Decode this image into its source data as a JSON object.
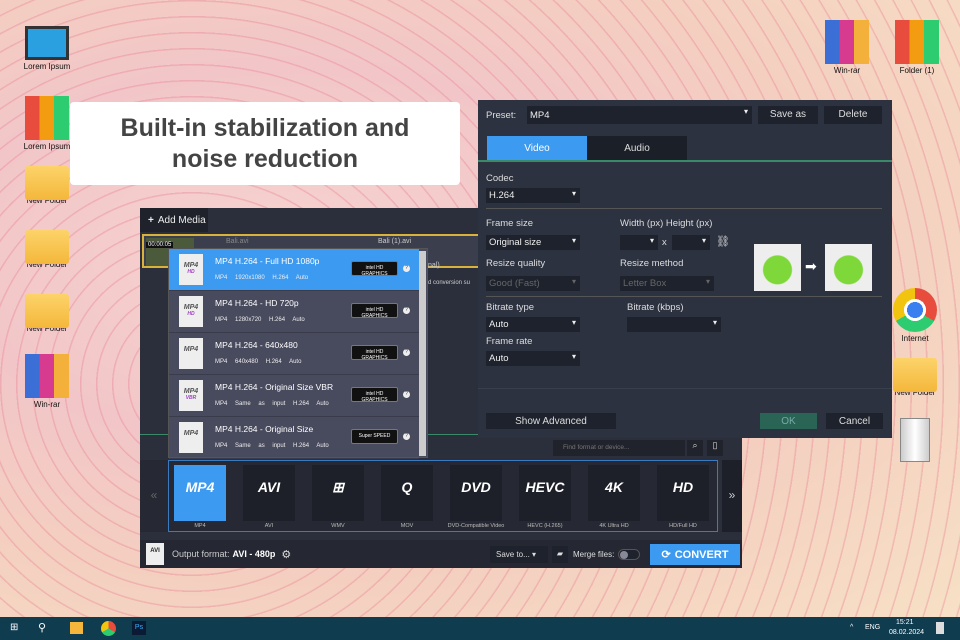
{
  "banner": {
    "text": "Built-in stabilization and noise reduction"
  },
  "desktop": {
    "left": [
      {
        "label": "Lorem Ipsum",
        "icon": "computer-icon"
      },
      {
        "label": "Lorem Ipsum",
        "icon": "binders-icon"
      },
      {
        "label": "New Folder",
        "icon": "folder-icon"
      },
      {
        "label": "New Folder",
        "icon": "folder-icon"
      },
      {
        "label": "New Folder",
        "icon": "folder-icon"
      },
      {
        "label": "Win-rar",
        "icon": "winrar-icon"
      }
    ],
    "right": [
      {
        "label": "Win-rar",
        "icon": "winrar-icon"
      },
      {
        "label": "Folder (1)",
        "icon": "binders-icon"
      },
      {
        "label": "Internet",
        "icon": "chrome-icon"
      },
      {
        "label": "New Folder",
        "icon": "folder-icon"
      },
      {
        "label": "",
        "icon": "recycle-bin-icon"
      }
    ]
  },
  "converter": {
    "add_media": "Add Media",
    "file": {
      "time": "00:00:05",
      "name": "Bali.avi",
      "output": "Bali (1).avi",
      "partial1": "nal)",
      "partial2": "d conversion su"
    },
    "presets": [
      {
        "title": "MP4 H.264 - Full HD 1080p",
        "specs": [
          "MP4",
          "1920x1080",
          "H.264",
          "Auto"
        ],
        "tag": "HD",
        "badge": "intel HD GRAPHICS",
        "selected": true
      },
      {
        "title": "MP4 H.264 - HD 720p",
        "specs": [
          "MP4",
          "1280x720",
          "H.264",
          "Auto"
        ],
        "tag": "HD",
        "badge": "intel HD GRAPHICS"
      },
      {
        "title": "MP4 H.264 - 640x480",
        "specs": [
          "MP4",
          "640x480",
          "H.264",
          "Auto"
        ],
        "tag": "",
        "badge": "intel HD GRAPHICS"
      },
      {
        "title": "MP4 H.264 - Original Size VBR",
        "specs": [
          "MP4",
          "Same as input",
          "H.264",
          "Auto"
        ],
        "tag": "VBR",
        "badge": "intel HD GRAPHICS"
      },
      {
        "title": "MP4 H.264 - Original Size",
        "specs": [
          "MP4",
          "Same as input",
          "H.264",
          "Auto"
        ],
        "tag": "",
        "badge": "Super SPEED"
      }
    ],
    "search_placeholder": "Find format or device...",
    "formats": [
      {
        "logo": "MP4",
        "label": "MP4",
        "selected": true
      },
      {
        "logo": "AVI",
        "label": "AVI"
      },
      {
        "logo": "⊞",
        "label": "WMV"
      },
      {
        "logo": "Q",
        "label": "MOV"
      },
      {
        "logo": "DVD",
        "label": "DVD-Compatible Video"
      },
      {
        "logo": "HEVC",
        "label": "HEVC (H.265)"
      },
      {
        "logo": "4K",
        "label": "4K Ultra HD"
      },
      {
        "logo": "HD",
        "label": "HD/Full HD"
      }
    ],
    "output_label": "Output format:",
    "output_value": "AVI - 480p",
    "save_to": "Save to...",
    "merge": "Merge files:",
    "merge_on": false,
    "convert": "CONVERT",
    "accent": "#3c9af0"
  },
  "settings": {
    "preset_label": "Preset:",
    "preset_value": "MP4",
    "save_as": "Save as",
    "delete": "Delete",
    "tabs": [
      "Video",
      "Audio"
    ],
    "active_tab": "Video",
    "codec_label": "Codec",
    "codec": "H.264",
    "frame_size_label": "Frame size",
    "frame_size": "Original size",
    "wh_label": "Width (px) Height (px)",
    "x": "x",
    "resize_quality_label": "Resize quality",
    "resize_quality": "Good (Fast)",
    "resize_method_label": "Resize method",
    "resize_method": "Letter Box",
    "bitrate_type_label": "Bitrate type",
    "bitrate_type": "Auto",
    "bitrate_label": "Bitrate (kbps)",
    "frame_rate_label": "Frame rate",
    "frame_rate": "Auto",
    "show_advanced": "Show Advanced",
    "ok": "OK",
    "cancel": "Cancel"
  },
  "taskbar": {
    "lang": "ENG",
    "time": "15:21",
    "date": "08.02.2024"
  }
}
